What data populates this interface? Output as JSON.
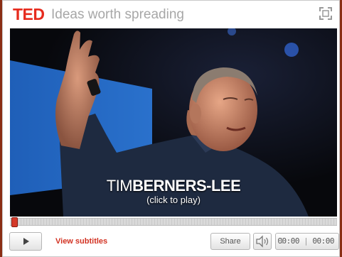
{
  "header": {
    "logo": "TED",
    "tagline": "Ideas worth spreading",
    "fullscreen_icon": "fullscreen-icon"
  },
  "video": {
    "speaker_first": "TIM",
    "speaker_last": "BERNERS-LEE",
    "hint": "(click to play)"
  },
  "progress": {
    "played_fraction": 0.0
  },
  "controls": {
    "play_icon": "play-icon",
    "subtitles_label": "View subtitles",
    "share_label": "Share",
    "volume_icon": "volume-icon",
    "current_time": "00:00",
    "separator": "|",
    "duration": "00:00"
  },
  "colors": {
    "brand_red": "#e62b1e",
    "subtitle_red": "#d23222",
    "frame": "#8a2e14"
  }
}
